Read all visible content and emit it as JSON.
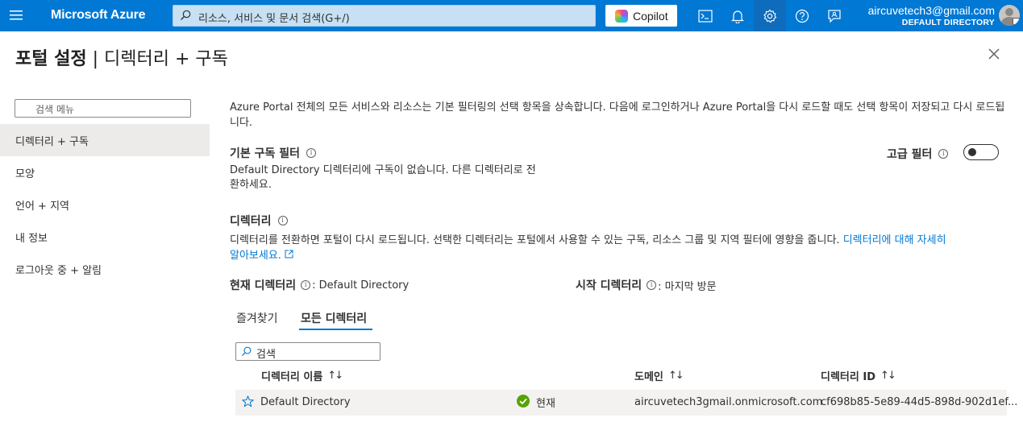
{
  "topbar": {
    "brand": "Microsoft Azure",
    "search_placeholder": "리소스, 서비스 및 문서 검색(G+/)",
    "copilot_label": "Copilot",
    "account_email": "aircuvetech3@gmail.com",
    "account_directory": "DEFAULT DIRECTORY",
    "accent_color": "#0078d4"
  },
  "page": {
    "title_bold": "포털 설정",
    "title_sep": " | ",
    "title_rest": "디렉터리 + 구독"
  },
  "menu": {
    "search_placeholder": "검색 메뉴",
    "items": [
      {
        "label": "디렉터리 + 구독",
        "active": true
      },
      {
        "label": "모양"
      },
      {
        "label": "언어 + 지역"
      },
      {
        "label": "내 정보"
      },
      {
        "label": "로그아웃 중 + 알림"
      }
    ]
  },
  "main": {
    "description": "Azure Portal 전체의 모든 서비스와 리소스는 기본 필터링의 선택 항목을 상속합니다. 다음에 로그인하거나 Azure Portal을 다시 로드할 때도 선택 항목이 저장되고 다시 로드됩니다.",
    "default_filter_heading": "기본 구독 필터",
    "default_filter_text_1": "Default Directory 디렉터리에 구독이 없습니다. 다른 디렉터리로 전",
    "default_filter_text_2": "환하세요.",
    "advanced_filter_label": "고급 필터",
    "directory_heading": "디렉터리",
    "directory_text": "디렉터리를 전환하면 포털이 다시 로드됩니다. 선택한 디렉터리는 포털에서 사용할 수 있는 구독, 리소스 그룹 및 지역 필터에 영향을 줍니다.",
    "directory_link_1": "디렉터리에 대해 자세히",
    "directory_link_2": "알아보세요.",
    "current_dir_label": "현재 디렉터리",
    "current_dir_value": ": Default Directory",
    "start_dir_label": "시작 디렉터리",
    "start_dir_value": ": 마지막 방문"
  },
  "tabs": [
    {
      "label": "즐겨찾기"
    },
    {
      "label": "모든 디렉터리",
      "active": true
    }
  ],
  "table": {
    "search_placeholder": "검색",
    "columns": [
      "디렉터리 이름",
      "도메인",
      "디렉터리 ID"
    ],
    "sort_glyph": "↑↓",
    "rows": [
      {
        "name": "Default Directory",
        "status": "현재",
        "domain": "aircuvetech3gmail.onmicrosoft.com",
        "id": "cf698b85-5e89-44d5-898d-902d1ef..."
      }
    ]
  }
}
